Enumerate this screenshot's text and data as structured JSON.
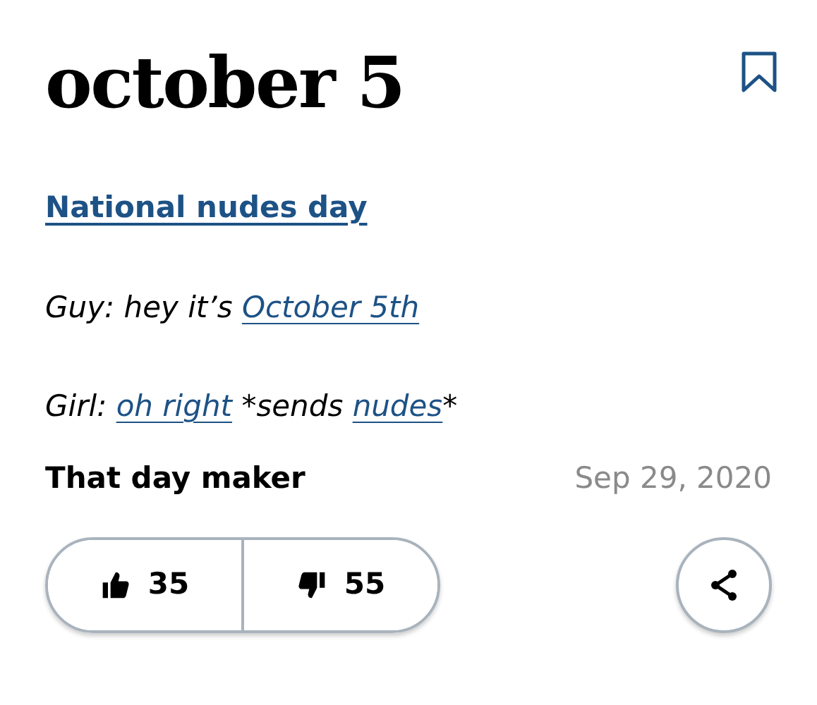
{
  "word": "october 5",
  "definition": "National nudes day",
  "example_lines": [
    [
      {
        "kind": "text",
        "text": "Guy: hey it’s "
      },
      {
        "kind": "link",
        "text": "October 5th"
      }
    ],
    [
      {
        "kind": "text",
        "text": "Girl: "
      },
      {
        "kind": "link",
        "text": "oh right"
      },
      {
        "kind": "text",
        "text": " *sends "
      },
      {
        "kind": "link",
        "text": "nudes"
      },
      {
        "kind": "text",
        "text": "*"
      }
    ]
  ],
  "author": "That day maker",
  "date": "Sep 29, 2020",
  "upvotes": "35",
  "downvotes": "55"
}
